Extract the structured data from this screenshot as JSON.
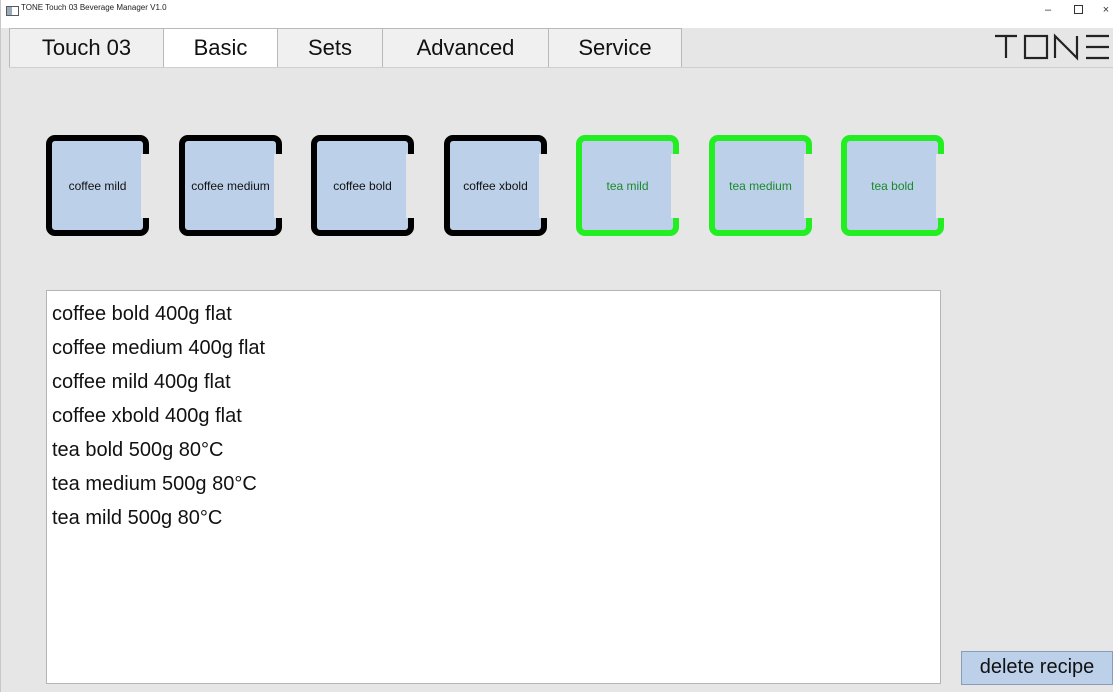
{
  "window": {
    "title": "TONE Touch 03   Beverage Manager   V1.0",
    "controls": {
      "minimize": "–",
      "close": "×"
    },
    "icon": "app-window-icon"
  },
  "logo": {
    "text": "TONE",
    "icon": "tone-logo-icon"
  },
  "tabs": [
    {
      "label": "Touch 03",
      "active": false
    },
    {
      "label": "Basic",
      "active": true
    },
    {
      "label": "Sets",
      "active": false
    },
    {
      "label": "Advanced",
      "active": false
    },
    {
      "label": "Service",
      "active": false
    }
  ],
  "recipe_buttons": [
    {
      "label": "coffee mild",
      "type": "coffee"
    },
    {
      "label": "coffee medium",
      "type": "coffee"
    },
    {
      "label": "coffee bold",
      "type": "coffee"
    },
    {
      "label": "coffee xbold",
      "type": "coffee"
    },
    {
      "label": "tea mild",
      "type": "tea"
    },
    {
      "label": "tea medium",
      "type": "tea"
    },
    {
      "label": "tea bold",
      "type": "tea"
    }
  ],
  "recipe_list": [
    "coffee bold 400g flat",
    "coffee medium 400g flat",
    "coffee mild 400g flat",
    "coffee xbold 400g flat",
    "tea bold 500g 80°C",
    "tea medium 500g 80°C",
    "tea mild 500g 80°C"
  ],
  "delete_button": {
    "label": "delete recipe"
  },
  "colors": {
    "background": "#e6e6e6",
    "button_fill": "#bcd0ea",
    "coffee_border": "#000000",
    "tea_border": "#22ee22",
    "tea_text": "#1b8a2a"
  }
}
